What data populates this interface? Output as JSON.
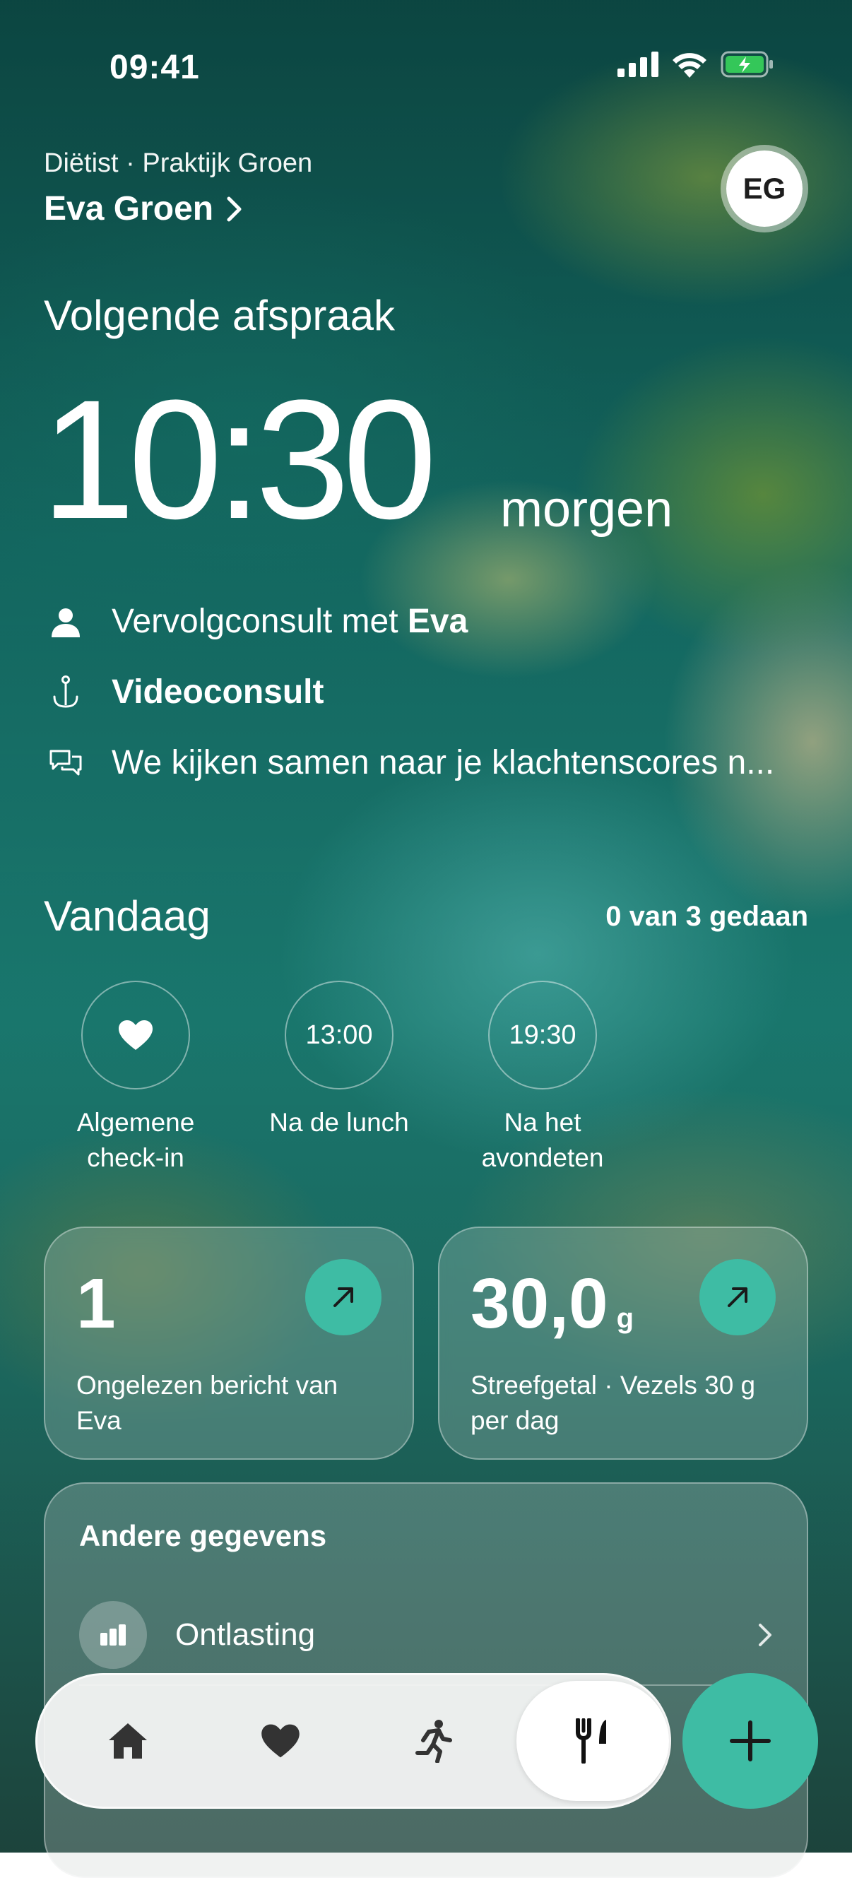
{
  "status_bar": {
    "time": "09:41"
  },
  "header": {
    "subtitle": "Diëtist · Praktijk Groen",
    "name": "Eva Groen",
    "avatar_initials": "EG"
  },
  "next_appointment": {
    "heading": "Volgende afspraak",
    "time": "10:30",
    "day": "morgen",
    "details": [
      {
        "icon": "person-icon",
        "text": "Vervolgconsult met ",
        "bold": "Eva"
      },
      {
        "icon": "anchor-icon",
        "text": "",
        "bold": "Videoconsult"
      },
      {
        "icon": "chat-bubbles-icon",
        "text": "We kijken samen naar je klachtenscores n...",
        "bold": ""
      }
    ]
  },
  "today": {
    "heading": "Vandaag",
    "progress": "0 van 3 gedaan",
    "tasks": [
      {
        "circle": "",
        "icon": "heart-icon",
        "label_line1": "Algemene",
        "label_line2": "check-in"
      },
      {
        "circle": "13:00",
        "label_line1": "Na de lunch",
        "label_line2": ""
      },
      {
        "circle": "19:30",
        "label_line1": "Na het",
        "label_line2": "avondeten"
      }
    ]
  },
  "cards": [
    {
      "value": "1",
      "unit": "",
      "description": "Ongelezen bericht van Eva"
    },
    {
      "value": "30,0",
      "unit": "g",
      "description": "Streefgetal · Vezels 30 g per dag"
    }
  ],
  "other_data": {
    "title": "Andere gegevens",
    "rows": [
      {
        "label": "Ontlasting"
      }
    ]
  },
  "tab_bar": {
    "tabs": [
      "home-icon",
      "heart-icon",
      "running-icon",
      "fork-knife-icon"
    ],
    "active": "fork-knife-icon"
  },
  "colors": {
    "accent": "#3ebca4"
  }
}
